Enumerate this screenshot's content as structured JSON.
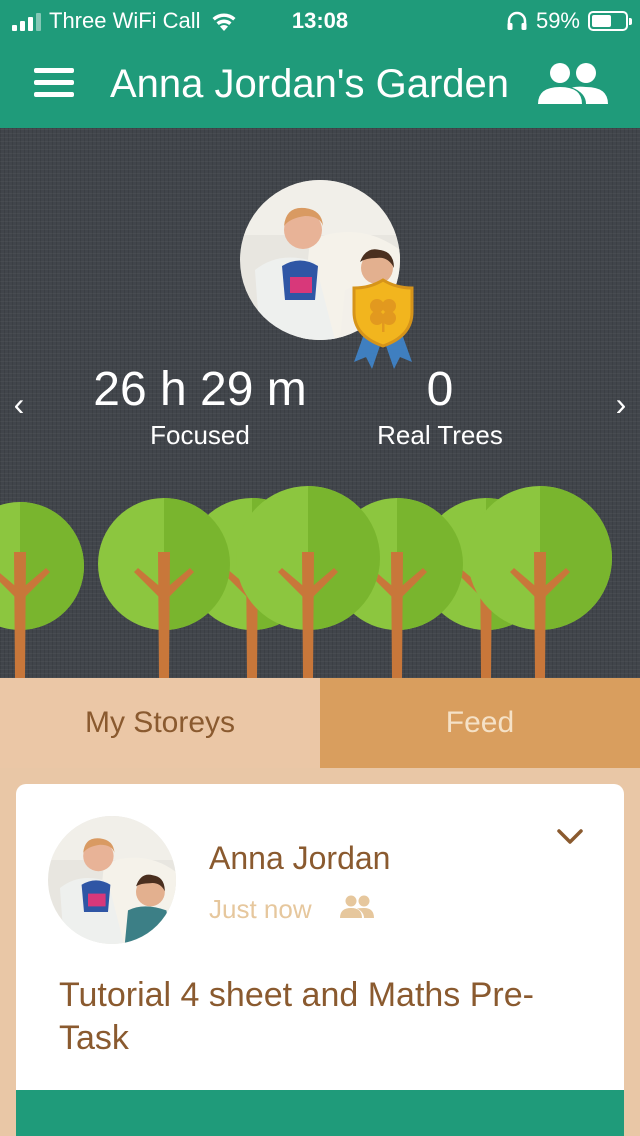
{
  "status_bar": {
    "carrier": "Three WiFi Call",
    "time": "13:08",
    "battery_percent": "59%",
    "battery_level": 0.59,
    "icons": [
      "signal-icon",
      "wifi-icon",
      "headphones-icon",
      "battery-icon"
    ]
  },
  "app_bar": {
    "title": "Anna Jordan's Garden",
    "icons": [
      "menu-icon",
      "friends-icon"
    ]
  },
  "profile": {
    "focused_value": "26 h 29 m",
    "focused_label": "Focused",
    "real_trees_value": "0",
    "real_trees_label": "Real Trees",
    "prev_arrow": "‹",
    "next_arrow": "›",
    "badge_icon": "clover-badge-icon"
  },
  "tabs": [
    {
      "label": "My Storeys",
      "active": true
    },
    {
      "label": "Feed",
      "active": false
    }
  ],
  "feed_card": {
    "name": "Anna Jordan",
    "time": "Just now",
    "text": "Tutorial 4 sheet and Maths Pre-Task",
    "icons": [
      "friends-visibility-icon",
      "chevron-down-icon"
    ]
  },
  "colors": {
    "primary_green": "#1f9b7a",
    "background_dark": "#41454b",
    "tab_active_bg": "#ebc7a6",
    "tab_inactive_bg": "#d99e5e",
    "text_brown": "#8a5a2f",
    "tree_green": "#8cc63f",
    "tree_trunk": "#c8773a"
  }
}
